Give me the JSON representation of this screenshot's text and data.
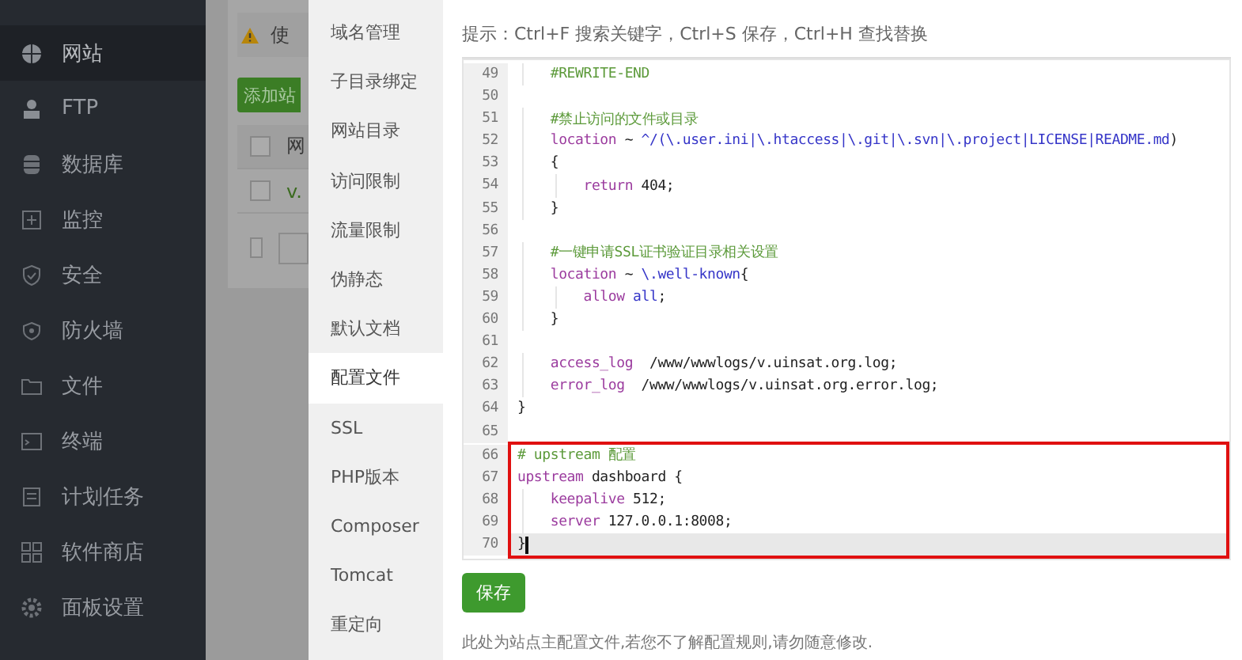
{
  "sidebar": {
    "items": [
      {
        "label": "网站",
        "selected": true
      },
      {
        "label": "FTP",
        "selected": false
      },
      {
        "label": "数据库",
        "selected": false
      },
      {
        "label": "监控",
        "selected": false
      },
      {
        "label": "安全",
        "selected": false
      },
      {
        "label": "防火墙",
        "selected": false
      },
      {
        "label": "文件",
        "selected": false
      },
      {
        "label": "终端",
        "selected": false
      },
      {
        "label": "计划任务",
        "selected": false
      },
      {
        "label": "软件商店",
        "selected": false
      },
      {
        "label": "面板设置",
        "selected": false
      }
    ]
  },
  "background_page": {
    "notice": "使",
    "add_button": "添加站",
    "table_header": "网",
    "row_site": "v.",
    "checkboxes": [
      {
        "checked": false
      },
      {
        "checked": false
      },
      {
        "checked": false
      }
    ]
  },
  "modal": {
    "nav": [
      {
        "label": "域名管理",
        "selected": false
      },
      {
        "label": "子目录绑定",
        "selected": false
      },
      {
        "label": "网站目录",
        "selected": false
      },
      {
        "label": "访问限制",
        "selected": false
      },
      {
        "label": "流量限制",
        "selected": false
      },
      {
        "label": "伪静态",
        "selected": false
      },
      {
        "label": "默认文档",
        "selected": false
      },
      {
        "label": "配置文件",
        "selected": true
      },
      {
        "label": "SSL",
        "selected": false
      },
      {
        "label": "PHP版本",
        "selected": false
      },
      {
        "label": "Composer",
        "selected": false
      },
      {
        "label": "Tomcat",
        "selected": false
      },
      {
        "label": "重定向",
        "selected": false
      }
    ],
    "hint": "提示：Ctrl+F 搜索关键字，Ctrl+S 保存，Ctrl+H 查找替换",
    "editor": {
      "lines": [
        {
          "number": "49",
          "highlighted": false,
          "current": false,
          "tokens": [
            {
              "text": "    #REWRITE-END",
              "kind": "comment"
            }
          ]
        },
        {
          "number": "50",
          "highlighted": false,
          "current": false
        },
        {
          "number": "51",
          "highlighted": false,
          "current": false,
          "tokens": [
            {
              "text": "    #禁止访问的文件或目录",
              "kind": "comment"
            }
          ]
        },
        {
          "number": "52",
          "highlighted": false,
          "current": false,
          "tokens": [
            {
              "text": "    location",
              "kind": "keyword"
            },
            {
              "text": " ~ ",
              "kind": "plain"
            },
            {
              "text": "^/(\\.user.ini|\\.htaccess|\\.git|\\.svn|\\.project|LICENSE|README.md",
              "kind": "atom"
            },
            {
              "text": ")",
              "kind": "plain"
            }
          ]
        },
        {
          "number": "53",
          "highlighted": false,
          "current": false,
          "tokens": [
            {
              "text": "    {",
              "kind": "plain"
            }
          ]
        },
        {
          "number": "54",
          "highlighted": false,
          "current": false,
          "tokens": [
            {
              "text": "        return",
              "kind": "keyword"
            },
            {
              "text": " 404;",
              "kind": "plain"
            }
          ]
        },
        {
          "number": "55",
          "highlighted": false,
          "current": false,
          "tokens": [
            {
              "text": "    }",
              "kind": "plain"
            }
          ]
        },
        {
          "number": "56",
          "highlighted": false,
          "current": false
        },
        {
          "number": "57",
          "highlighted": false,
          "current": false,
          "tokens": [
            {
              "text": "    #一键申请SSL证书验证目录相关设置",
              "kind": "comment"
            }
          ]
        },
        {
          "number": "58",
          "highlighted": false,
          "current": false,
          "tokens": [
            {
              "text": "    location",
              "kind": "keyword"
            },
            {
              "text": " ~ ",
              "kind": "plain"
            },
            {
              "text": "\\.well-known",
              "kind": "atom"
            },
            {
              "text": "{",
              "kind": "plain"
            }
          ]
        },
        {
          "number": "59",
          "highlighted": false,
          "current": false,
          "tokens": [
            {
              "text": "        allow",
              "kind": "keyword"
            },
            {
              "text": " all",
              "kind": "atom"
            },
            {
              "text": ";",
              "kind": "plain"
            }
          ]
        },
        {
          "number": "60",
          "highlighted": false,
          "current": false,
          "tokens": [
            {
              "text": "    }",
              "kind": "plain"
            }
          ]
        },
        {
          "number": "61",
          "highlighted": false,
          "current": false
        },
        {
          "number": "62",
          "highlighted": false,
          "current": false,
          "tokens": [
            {
              "text": "    access_log",
              "kind": "keyword"
            },
            {
              "text": "  /www/wwwlogs/v.uinsat.org.log;",
              "kind": "plain"
            }
          ]
        },
        {
          "number": "63",
          "highlighted": false,
          "current": false,
          "tokens": [
            {
              "text": "    error_log",
              "kind": "keyword"
            },
            {
              "text": "  /www/wwwlogs/v.uinsat.org.error.log;",
              "kind": "plain"
            }
          ]
        },
        {
          "number": "64",
          "highlighted": false,
          "current": false,
          "tokens": [
            {
              "text": "}",
              "kind": "plain"
            }
          ]
        },
        {
          "number": "65",
          "highlighted": false,
          "current": false
        },
        {
          "number": "66",
          "highlighted": true,
          "current": false,
          "tokens": [
            {
              "text": "# upstream 配置",
              "kind": "comment"
            }
          ]
        },
        {
          "number": "67",
          "highlighted": true,
          "current": false,
          "tokens": [
            {
              "text": "upstream",
              "kind": "keyword"
            },
            {
              "text": " dashboard {",
              "kind": "plain"
            }
          ]
        },
        {
          "number": "68",
          "highlighted": true,
          "current": false,
          "tokens": [
            {
              "text": "    keepalive",
              "kind": "keyword"
            },
            {
              "text": " 512;",
              "kind": "plain"
            }
          ]
        },
        {
          "number": "69",
          "highlighted": true,
          "current": false,
          "tokens": [
            {
              "text": "    server",
              "kind": "keyword"
            },
            {
              "text": " 127.0.0.1:8008;",
              "kind": "plain"
            }
          ]
        },
        {
          "number": "70",
          "highlighted": true,
          "current": true,
          "tokens": [
            {
              "text": "}",
              "kind": "plain"
            }
          ]
        }
      ]
    },
    "save_button": "保存",
    "note": "此处为站点主配置文件,若您不了解配置规则,请勿随意修改."
  }
}
